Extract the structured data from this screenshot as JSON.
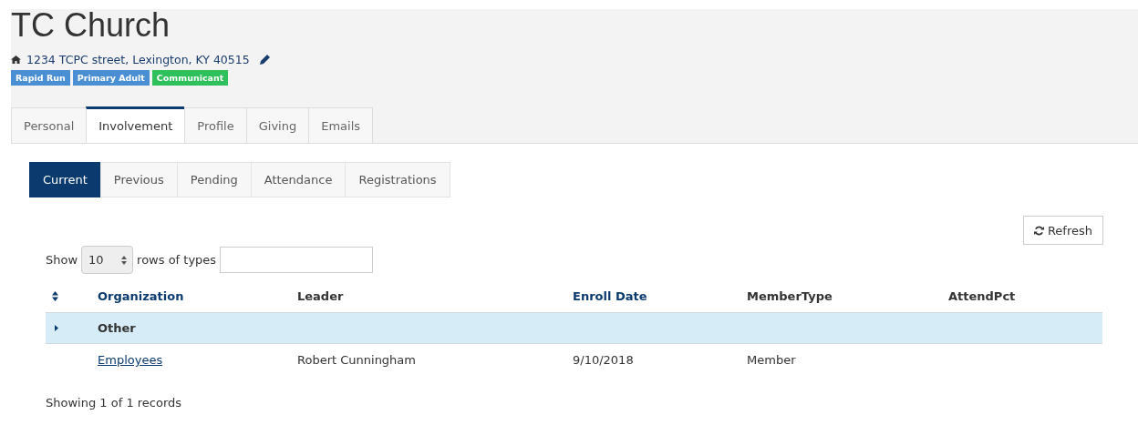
{
  "title": "TC Church",
  "address": "1234 TCPC street, Lexington, KY 40515",
  "badges": [
    {
      "label": "Rapid Run",
      "color": "#4a8fd4"
    },
    {
      "label": "Primary Adult",
      "color": "#4a8fd4"
    },
    {
      "label": "Communicant",
      "color": "#2ec05a"
    }
  ],
  "tabs": [
    {
      "label": "Personal",
      "selected": false
    },
    {
      "label": "Involvement",
      "selected": true
    },
    {
      "label": "Profile",
      "selected": false
    },
    {
      "label": "Giving",
      "selected": false
    },
    {
      "label": "Emails",
      "selected": false
    }
  ],
  "subtabs": [
    {
      "label": "Current",
      "selected": true
    },
    {
      "label": "Previous",
      "selected": false
    },
    {
      "label": "Pending",
      "selected": false
    },
    {
      "label": "Attendance",
      "selected": false
    },
    {
      "label": "Registrations",
      "selected": false
    }
  ],
  "refresh_button": "Refresh",
  "filter": {
    "show_label": "Show",
    "page_size": "10",
    "types_label": "rows of types"
  },
  "table": {
    "columns": [
      {
        "label": "Organization",
        "sortable": true
      },
      {
        "label": "Leader",
        "sortable": false
      },
      {
        "label": "Enroll Date",
        "sortable": true
      },
      {
        "label": "MemberType",
        "sortable": false
      },
      {
        "label": "AttendPct",
        "sortable": false
      }
    ],
    "groups": [
      {
        "name": "Other",
        "expanded": false,
        "rows": [
          {
            "organization": "Employees",
            "leader": "Robert Cunningham",
            "enroll_date": "9/10/2018",
            "member_type": "Member"
          }
        ]
      }
    ]
  },
  "footer": "Showing 1 of 1 records"
}
